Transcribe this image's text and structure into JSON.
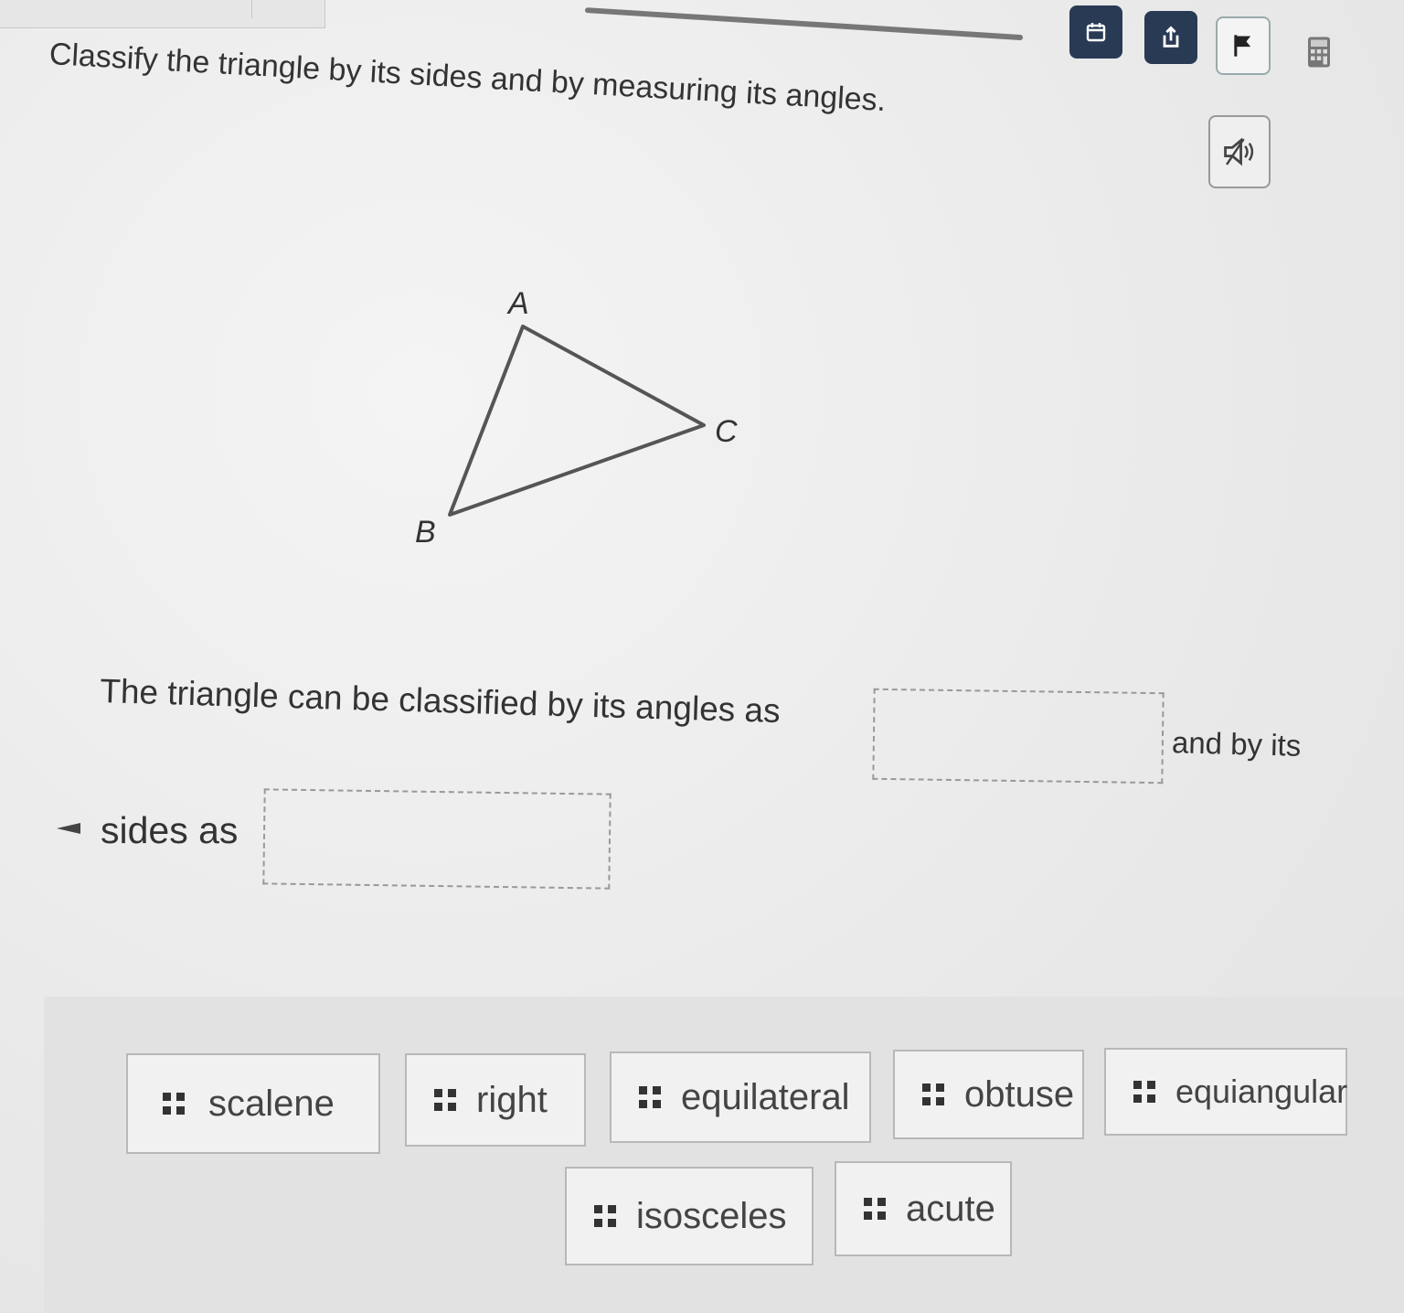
{
  "question": {
    "prompt": "Classify the triangle by its sides and by measuring its angles."
  },
  "figure": {
    "vertex_a": "A",
    "vertex_b": "B",
    "vertex_c": "C"
  },
  "answer": {
    "sentence_part_1": "The triangle can be classified by its angles as",
    "sentence_part_2": "and by its",
    "sentence_part_3": "sides as",
    "blank_1_value": "",
    "blank_2_value": ""
  },
  "choices": [
    "scalene",
    "right",
    "equilateral",
    "obtuse",
    "equiangular",
    "isosceles",
    "acute"
  ],
  "toolbar": {
    "icons": [
      "calendar-icon",
      "share-icon",
      "flag-icon",
      "calculator-icon"
    ],
    "audio_icon": "speaker-icon"
  },
  "colors": {
    "dark_button": "#283a54",
    "page_bg": "#ededed"
  }
}
